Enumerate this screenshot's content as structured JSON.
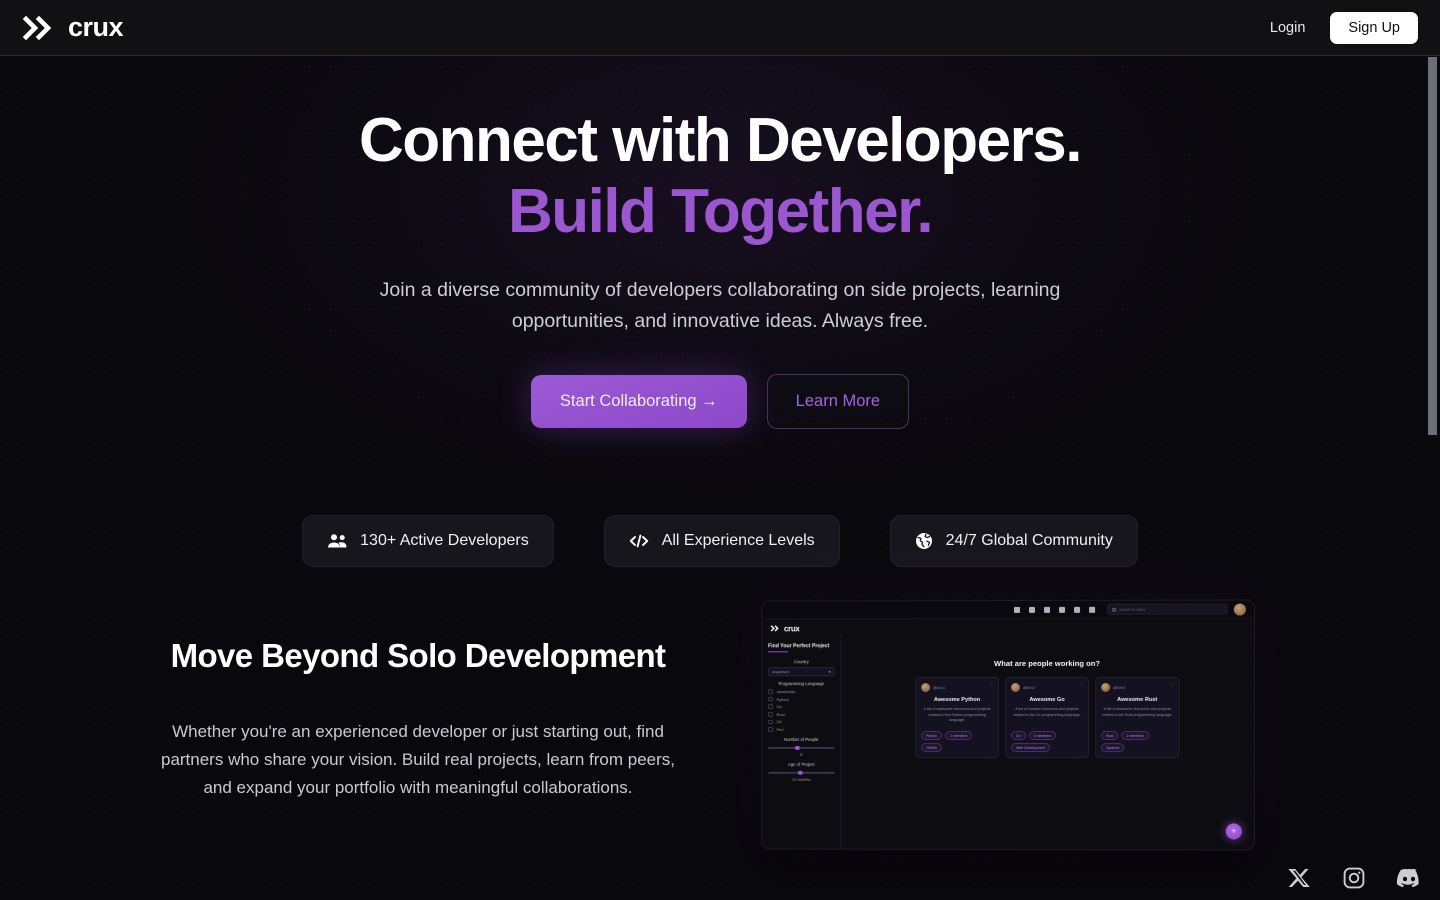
{
  "brand": {
    "name": "crux",
    "logo_icon": "double-chevron-icon"
  },
  "header": {
    "login_label": "Login",
    "signup_label": "Sign Up"
  },
  "hero": {
    "title_line1": "Connect with Developers.",
    "title_line2": "Build Together.",
    "subtitle": "Join a diverse community of developers collaborating on side projects, learning opportunities, and innovative ideas. Always free.",
    "primary_cta": "Start Collaborating →",
    "secondary_cta": "Learn More",
    "accent_color": "#9a57cf",
    "stats": [
      {
        "icon": "users-icon",
        "label": "130+ Active Developers"
      },
      {
        "icon": "code-icon",
        "label": "All Experience Levels"
      },
      {
        "icon": "globe-icon",
        "label": "24/7 Global Community"
      }
    ]
  },
  "feature": {
    "heading": "Move Beyond Solo Development",
    "body": "Whether you're an experienced developer or just starting out, find partners who share your vision. Build real projects, learn from peers, and expand your portfolio with meaningful collaborations."
  },
  "mockup": {
    "logo_text": "crux",
    "search_placeholder": "search for users",
    "sidebar": {
      "title": "Find Your Perfect Project",
      "country_label": "Country",
      "country_value": "Anywhere",
      "language_label": "Programming Language",
      "languages": [
        "JavaScript",
        "Python",
        "Go",
        "Rust",
        "C#",
        "Perl"
      ],
      "people_label": "Number of People",
      "people_value": "5",
      "age_label": "Age of Project",
      "age_value": "12 months"
    },
    "main_heading": "What are people working on?",
    "cards": [
      {
        "user": "@Dev1",
        "star": "☆",
        "title": "Awesome Python",
        "desc": "A list of awesome resources and projects created in the Python programming language.",
        "tags": [
          "Python",
          "2 members",
          "GitHub"
        ]
      },
      {
        "user": "@Dev2",
        "star": "☆",
        "title": "Awesome Go",
        "desc": "A list of curated resources and projects related to the Go programming language.",
        "tags": [
          "Go",
          "3 members",
          "Web Development"
        ]
      },
      {
        "user": "@Dev3",
        "star": "☆",
        "title": "Awesome Rust",
        "desc": "A list of awesome resources and projects related to the Rust programming language.",
        "tags": [
          "Rust",
          "2 members",
          "Systems"
        ]
      }
    ],
    "fab_label": "+"
  },
  "social": [
    {
      "icon": "x-twitter-icon",
      "name": "X"
    },
    {
      "icon": "instagram-icon",
      "name": "Instagram"
    },
    {
      "icon": "discord-icon",
      "name": "Discord"
    }
  ]
}
